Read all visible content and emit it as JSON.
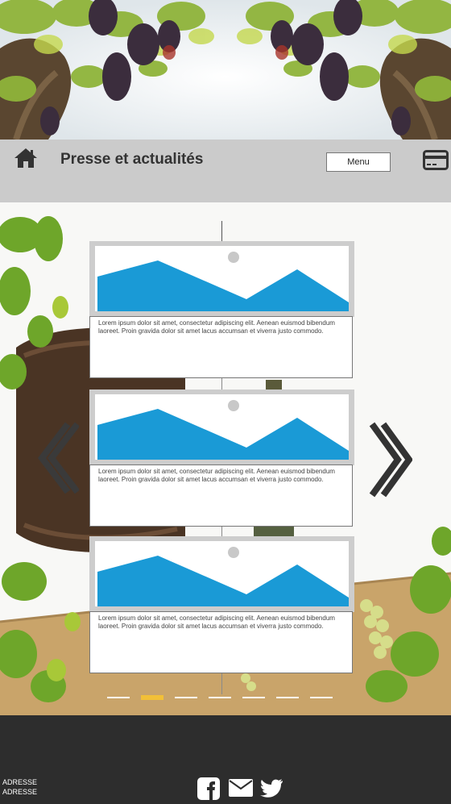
{
  "header": {
    "title": "Presse et actualités",
    "menu_label": "Menu",
    "home_icon": "home-icon",
    "card_icon": "credit-card-icon"
  },
  "articles": [
    {
      "text": "Lorem ipsum dolor sit amet, consectetur adipiscing elit. Aenean euismod bibendum laoreet. Proin gravida dolor sit amet lacus accumsan et viverra justo commodo."
    },
    {
      "text": "Lorem ipsum dolor sit amet, consectetur adipiscing elit. Aenean euismod bibendum laoreet. Proin gravida dolor sit amet lacus accumsan et viverra justo commodo."
    },
    {
      "text": "Lorem ipsum dolor sit amet, consectetur adipiscing elit. Aenean euismod bibendum laoreet. Proin gravida dolor sit amet lacus accumsan et viverra justo commodo."
    }
  ],
  "slider": {
    "prev_icon": "chevron-left-icon",
    "next_icon": "chevron-right-icon",
    "dot_count": 7,
    "active_index": 1
  },
  "footer": {
    "address_line1": "ADRESSE",
    "address_line2": "ADRESSE",
    "social": [
      "facebook-icon",
      "mail-icon",
      "twitter-icon"
    ]
  },
  "colors": {
    "header_bg": "#cbcbcb",
    "footer_bg": "#2d2d2d",
    "placeholder_blue": "#1a9ad6",
    "active_dot": "#f2c038"
  }
}
